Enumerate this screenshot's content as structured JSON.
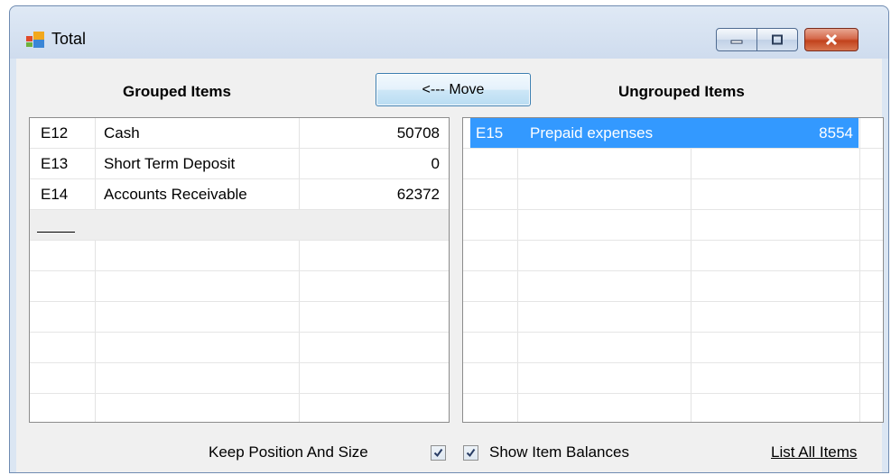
{
  "window": {
    "title": "Total"
  },
  "toolbar": {
    "move_label": "<--- Move"
  },
  "headers": {
    "grouped": "Grouped Items",
    "ungrouped": "Ungrouped Items"
  },
  "grouped": {
    "rows": [
      {
        "code": "E12",
        "name": "Cash",
        "value": "50708"
      },
      {
        "code": "E13",
        "name": "Short Term Deposit",
        "value": "0"
      },
      {
        "code": "E14",
        "name": "Accounts Receivable",
        "value": "62372"
      }
    ]
  },
  "ungrouped": {
    "rows": [
      {
        "code": "E15",
        "name": "Prepaid expenses",
        "value": "8554"
      }
    ]
  },
  "options": {
    "keep_position_label": "Keep Position And Size",
    "keep_position_checked": true,
    "show_balances_label": "Show Item Balances",
    "show_balances_checked": true,
    "list_all_label": "List All Items"
  },
  "colors": {
    "selection": "#3399ff",
    "accent": "#3c7fb1",
    "close": "#c2421c"
  },
  "icons": [
    "app-window-icon",
    "minimize-icon",
    "maximize-icon",
    "close-icon",
    "checkmark-icon"
  ]
}
